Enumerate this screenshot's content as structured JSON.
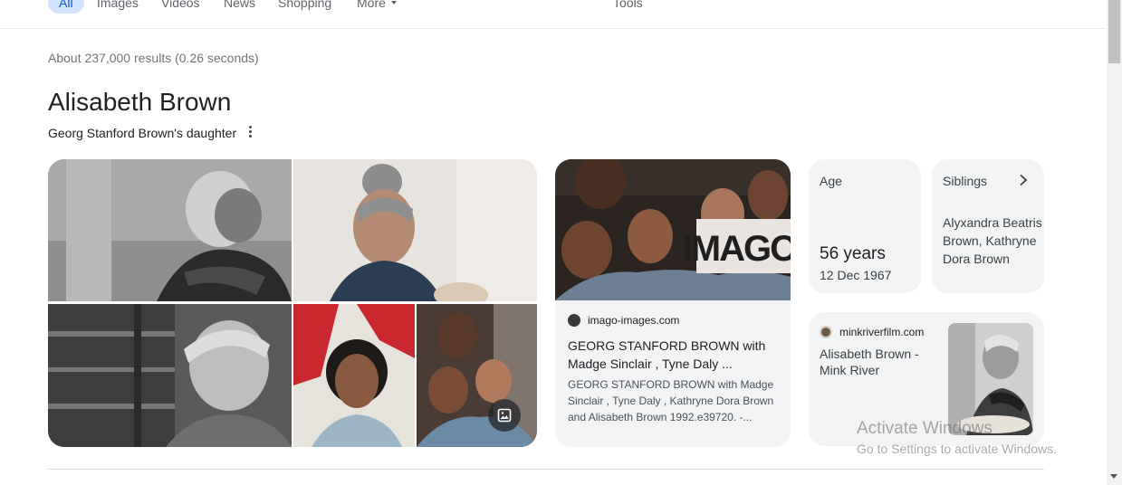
{
  "tabs": [
    {
      "label": "All",
      "active": true
    },
    {
      "label": "Images"
    },
    {
      "label": "Videos"
    },
    {
      "label": "News"
    },
    {
      "label": "Shopping"
    },
    {
      "label": "More"
    }
  ],
  "tools_label": "Tools",
  "result_stats": "About 237,000 results (0.26 seconds)",
  "entity": {
    "title": "Alisabeth Brown",
    "subtitle": "Georg Stanford Brown's daughter"
  },
  "imago_card": {
    "site": "imago-images.com",
    "title": "GEORG STANFORD BROWN with Madge Sinclair , Tyne Daly ...",
    "snippet": "GEORG STANFORD BROWN with Madge Sinclair , Tyne Daly , Kathryne Dora Brown and Alisabeth Brown 1992.e39720. -...",
    "watermark": "IMAGO."
  },
  "age_card": {
    "label": "Age",
    "value": "56 years",
    "date": "12 Dec 1967"
  },
  "siblings_card": {
    "label": "Siblings",
    "names": "Alyxandra Beatris Brown, Kathryne Dora Brown"
  },
  "mink_card": {
    "site": "minkriverfilm.com",
    "title": "Alisabeth Brown - Mink River"
  },
  "watermark": {
    "line1": "Activate Windows",
    "line2": "Go to Settings to activate Windows."
  },
  "colors": {
    "active_tab_bg": "#d3e3fd",
    "active_tab_text": "#0b57d0",
    "card_bg": "#f1f3f4"
  },
  "icons": [
    "more-vert-icon",
    "image-gallery-icon",
    "chevron-right-icon",
    "chevron-down-icon"
  ]
}
